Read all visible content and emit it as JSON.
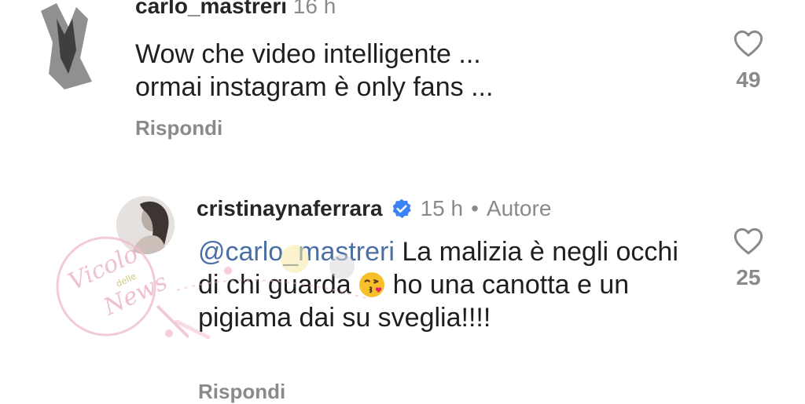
{
  "comments": [
    {
      "username": "carlo_mastreri",
      "time": "16 h",
      "text_line1": "Wow che video intelligente ...",
      "text_line2": "ormai instagram è only fans ...",
      "reply_label": "Rispondi",
      "likes": "49"
    },
    {
      "username": "cristinaynaferrara",
      "time": "15 h",
      "separator": "•",
      "author_label": "Autore",
      "mention": "@carlo_mastreri",
      "text_part1": " La malizia è negli occhi di chi guarda ",
      "text_part2": " ho una canotta e un pigiama dai su sveglia!!!!",
      "reply_label": "Rispondi",
      "likes": "25"
    }
  ],
  "icons": {
    "heart": "heart-icon",
    "verified": "verified-badge-icon",
    "emoji": "kiss-emoji-icon"
  },
  "watermark": {
    "line1": "Vicolo",
    "line2": "delle",
    "line3": "News"
  },
  "colors": {
    "muted": "#8a8a8a",
    "verified": "#3b82f6",
    "mention": "#4a6fa5",
    "watermark": "#e8a6c2"
  }
}
